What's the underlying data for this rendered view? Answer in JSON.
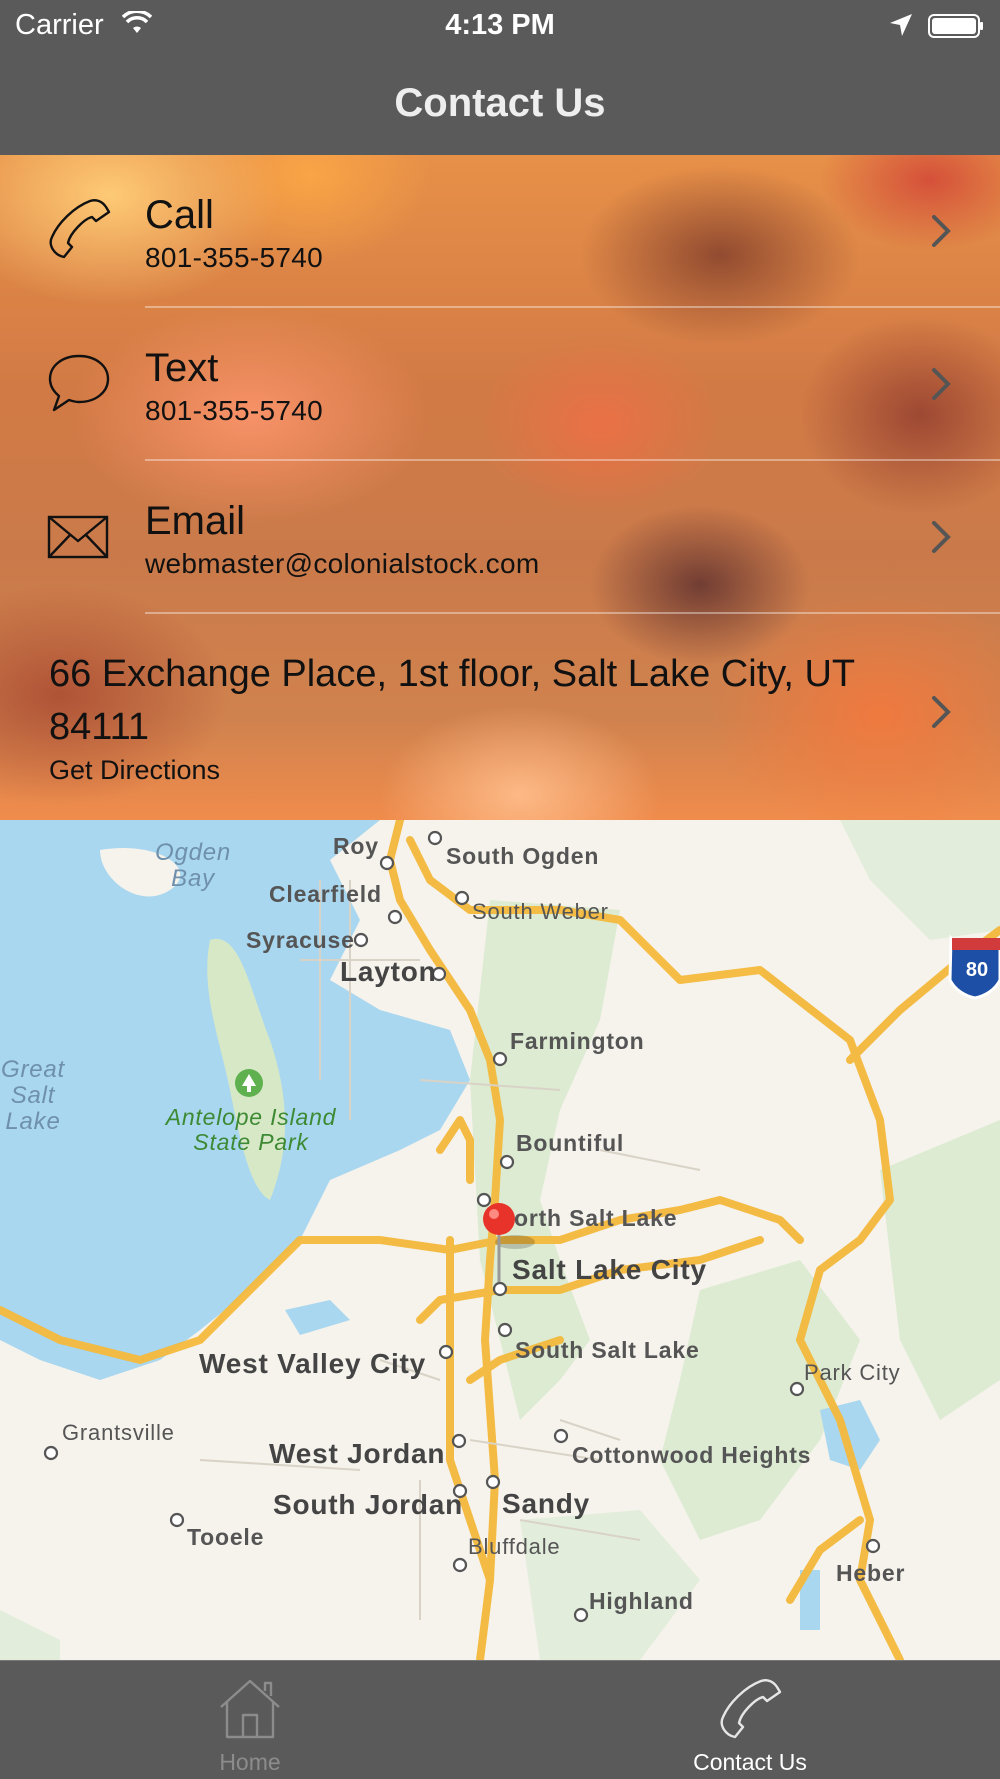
{
  "status_bar": {
    "carrier": "Carrier",
    "time": "4:13 PM"
  },
  "nav": {
    "title": "Contact Us"
  },
  "contacts": [
    {
      "label": "Call",
      "value": "801-355-5740",
      "icon": "phone-icon"
    },
    {
      "label": "Text",
      "value": "801-355-5740",
      "icon": "chat-bubble-icon"
    },
    {
      "label": "Email",
      "value": "webmaster@colonialstock.com",
      "icon": "envelope-icon"
    }
  ],
  "address": {
    "line": "66 Exchange Place, 1st floor, Salt Lake City, UT 84111",
    "action": "Get Directions"
  },
  "map": {
    "interstate": "80",
    "places": [
      "Roy",
      "South Ogden",
      "Clearfield",
      "South Weber",
      "Syracuse",
      "Layton",
      "Farmington",
      "Bountiful",
      "orth Salt Lake",
      "Salt Lake City",
      "South Salt Lake",
      "West Valley City",
      "Park City",
      "Grantsville",
      "Cottonwood Heights",
      "West Jordan",
      "South Jordan",
      "Sandy",
      "Tooele",
      "Bluffdale",
      "Heber",
      "Highland"
    ],
    "water": {
      "ogden_bay": "Ogden\nBay",
      "great_salt_lake": "Great\nSalt\nLake"
    },
    "park": "Antelope Island\nState Park"
  },
  "tabs": [
    {
      "label": "Home",
      "icon": "house-icon",
      "selected": false
    },
    {
      "label": "Contact Us",
      "icon": "phone-icon",
      "selected": true
    }
  ],
  "colors": {
    "bar_background": "#5a5a5a",
    "tab_inactive": "#8c8c8c",
    "tab_active": "#ffffff",
    "pin": "#e8332b"
  }
}
